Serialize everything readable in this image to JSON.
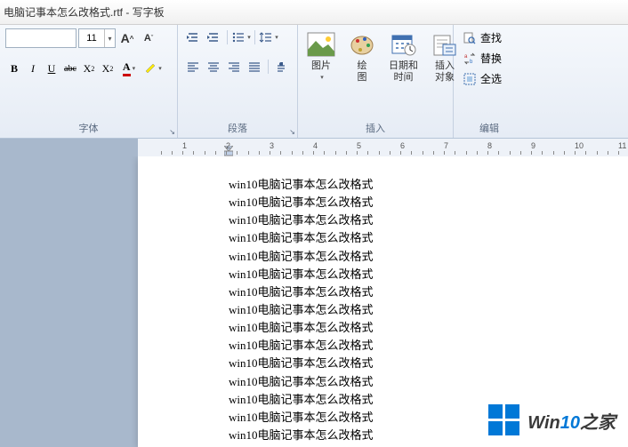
{
  "title": "电脑记事本怎么改格式.rtf - 写字板",
  "font": {
    "size": "11",
    "grow_label": "A",
    "shrink_label": "A",
    "bold": "B",
    "italic": "I",
    "underline": "U",
    "strike": "abc",
    "sub": "X",
    "sup": "X",
    "group_label": "字体"
  },
  "paragraph": {
    "group_label": "段落"
  },
  "insert": {
    "picture": "图片",
    "paint": "绘\n图",
    "datetime": "日期和\n时间",
    "object": "插入\n对象",
    "group_label": "插入"
  },
  "edit": {
    "find": "查找",
    "replace": "替换",
    "selectall": "全选",
    "group_label": "编辑"
  },
  "ruler": {
    "marks": [
      "1",
      "2",
      "3",
      "4",
      "5",
      "6",
      "7",
      "8",
      "9",
      "10",
      "11"
    ]
  },
  "document": {
    "lines": [
      "win10电脑记事本怎么改格式",
      "win10电脑记事本怎么改格式",
      "win10电脑记事本怎么改格式",
      "win10电脑记事本怎么改格式",
      "win10电脑记事本怎么改格式",
      "win10电脑记事本怎么改格式",
      "win10电脑记事本怎么改格式",
      "win10电脑记事本怎么改格式",
      "win10电脑记事本怎么改格式",
      "win10电脑记事本怎么改格式",
      "win10电脑记事本怎么改格式",
      "win10电脑记事本怎么改格式",
      "win10电脑记事本怎么改格式",
      "win10电脑记事本怎么改格式",
      "win10电脑记事本怎么改格式"
    ]
  },
  "watermark": {
    "text1": "Win",
    "text2": "10",
    "text3": "之家"
  }
}
